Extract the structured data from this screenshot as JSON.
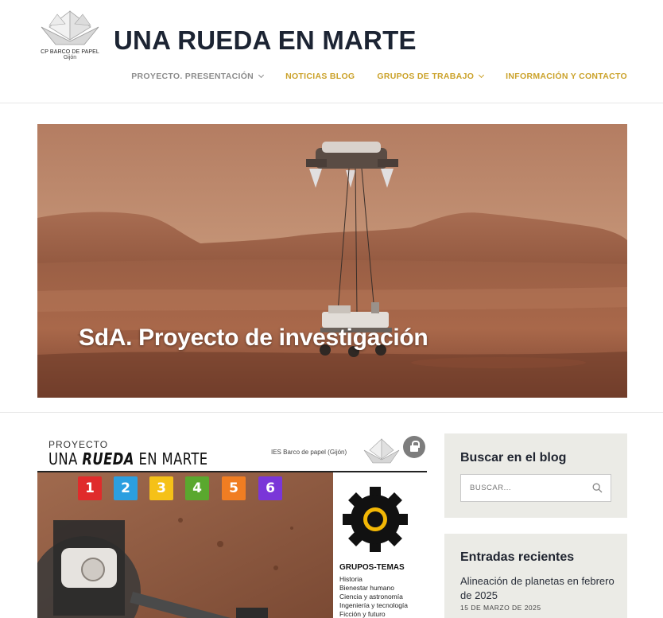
{
  "header": {
    "logo_line1": "CP BARCO DE PAPEL",
    "logo_line2": "Gijón",
    "site_title": "UNA RUEDA EN MARTE",
    "nav": [
      {
        "label": "PROYECTO. PRESENTACIÓN",
        "has_dropdown": true
      },
      {
        "label": "NOTICIAS BLOG",
        "has_dropdown": false
      },
      {
        "label": "GRUPOS DE TRABAJO",
        "has_dropdown": true
      },
      {
        "label": "INFORMACIÓN Y CONTACTO",
        "has_dropdown": false
      }
    ]
  },
  "hero": {
    "title": "SdA. Proyecto de investigación"
  },
  "poster": {
    "top_line": "PROYECTO",
    "title_a": "UNA ",
    "title_b": "RUEDA",
    "title_c": " EN MARTE",
    "school": "IES Barco de papel (Gijón)",
    "numbers": [
      "1",
      "2",
      "3",
      "4",
      "5",
      "6"
    ],
    "groups_title": "GRUPOS-TEMAS",
    "groups": [
      "Historia",
      "Bienestar humano",
      "Ciencia y astronomía",
      "Ingeniería y tecnología",
      "Ficción y futuro"
    ]
  },
  "sidebar": {
    "search_title": "Buscar en el blog",
    "search_placeholder": "BUSCAR...",
    "recent_title": "Entradas recientes",
    "recent_posts": [
      {
        "title": "Alineación de planetas en febrero de 2025",
        "date": "15 DE MARZO DE 2025"
      }
    ]
  },
  "colors": {
    "accent": "#cba22a",
    "nav_inactive": "#8c8c8c",
    "title": "#1c2433",
    "widget_bg": "#ebebe6"
  }
}
